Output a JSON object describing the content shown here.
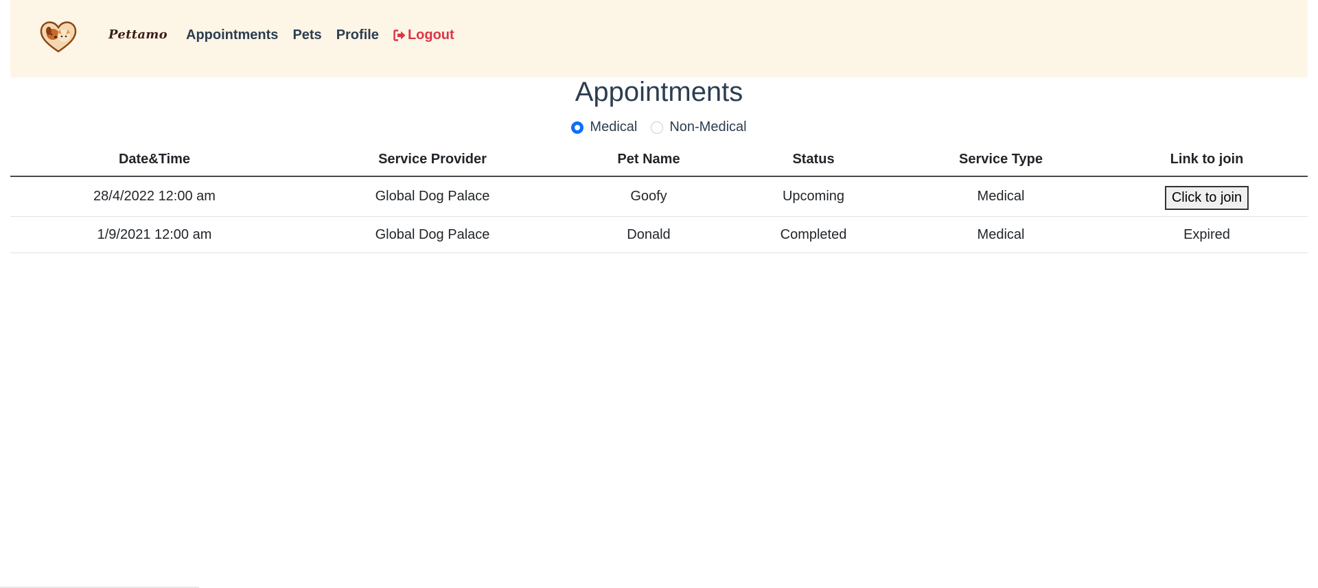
{
  "navbar": {
    "brand": "Pettamo",
    "logo_icon": "heart-pets-logo",
    "links": {
      "appointments": "Appointments",
      "pets": "Pets",
      "profile": "Profile",
      "logout": "Logout"
    },
    "logout_icon": "sign-out-icon",
    "colors": {
      "background": "#fdf5e6",
      "link": "#2c3e50",
      "logout": "#dc3545"
    }
  },
  "page": {
    "title": "Appointments"
  },
  "filter": {
    "options": {
      "medical": {
        "label": "Medical",
        "selected": true
      },
      "non_medical": {
        "label": "Non-Medical",
        "selected": false
      }
    }
  },
  "table": {
    "headers": {
      "datetime": "Date&Time",
      "provider": "Service Provider",
      "pet": "Pet Name",
      "status": "Status",
      "service_type": "Service Type",
      "link": "Link to join"
    },
    "rows": [
      {
        "datetime": "28/4/2022 12:00 am",
        "provider": "Global Dog Palace",
        "pet": "Goofy",
        "status": "Upcoming",
        "service_type": "Medical",
        "link": "Click to join"
      },
      {
        "datetime": "1/9/2021 12:00 am",
        "provider": "Global Dog Palace",
        "pet": "Donald",
        "status": "Completed",
        "service_type": "Medical",
        "link": "Expired"
      }
    ]
  }
}
